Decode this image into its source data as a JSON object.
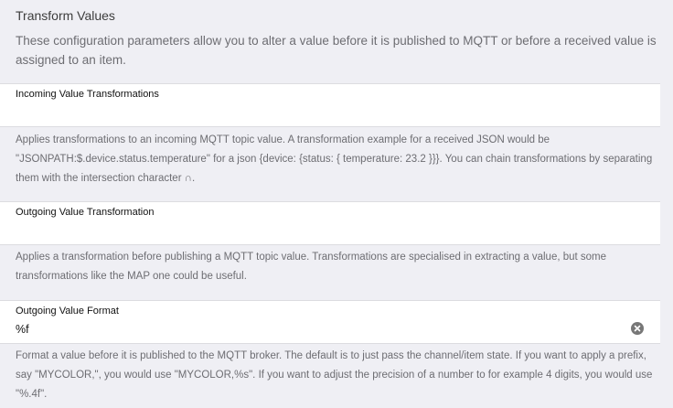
{
  "section": {
    "title": "Transform Values",
    "description": "These configuration parameters allow you to alter a value before it is published to MQTT or before a received value is assigned to an item."
  },
  "fields": [
    {
      "label": "Incoming Value Transformations",
      "value": "",
      "info": "Applies transformations to an incoming MQTT topic value. A transformation example for a received JSON would be \"JSONPATH:$.device.status.temperature\" for a json {device: {status: { temperature: 23.2 }}}. You can chain transformations by separating them with the intersection character ∩."
    },
    {
      "label": "Outgoing Value Transformation",
      "value": "",
      "info": "Applies a transformation before publishing a MQTT topic value. Transformations are specialised in extracting a value, but some transformations like the MAP one could be useful."
    },
    {
      "label": "Outgoing Value Format",
      "value": "%f",
      "info": "Format a value before it is published to the MQTT broker. The default is to just pass the channel/item state. If you want to apply a prefix, say \"MYCOLOR,\", you would use \"MYCOLOR,%s\". If you want to adjust the precision of a number to for example 4 digits, you would use \"%.4f\"."
    }
  ],
  "icons": {
    "clear": "clear-circle-icon"
  },
  "colors": {
    "background": "#efeff4",
    "field_background": "#ffffff",
    "text_secondary": "#6d6d72",
    "text_primary": "#111111"
  }
}
